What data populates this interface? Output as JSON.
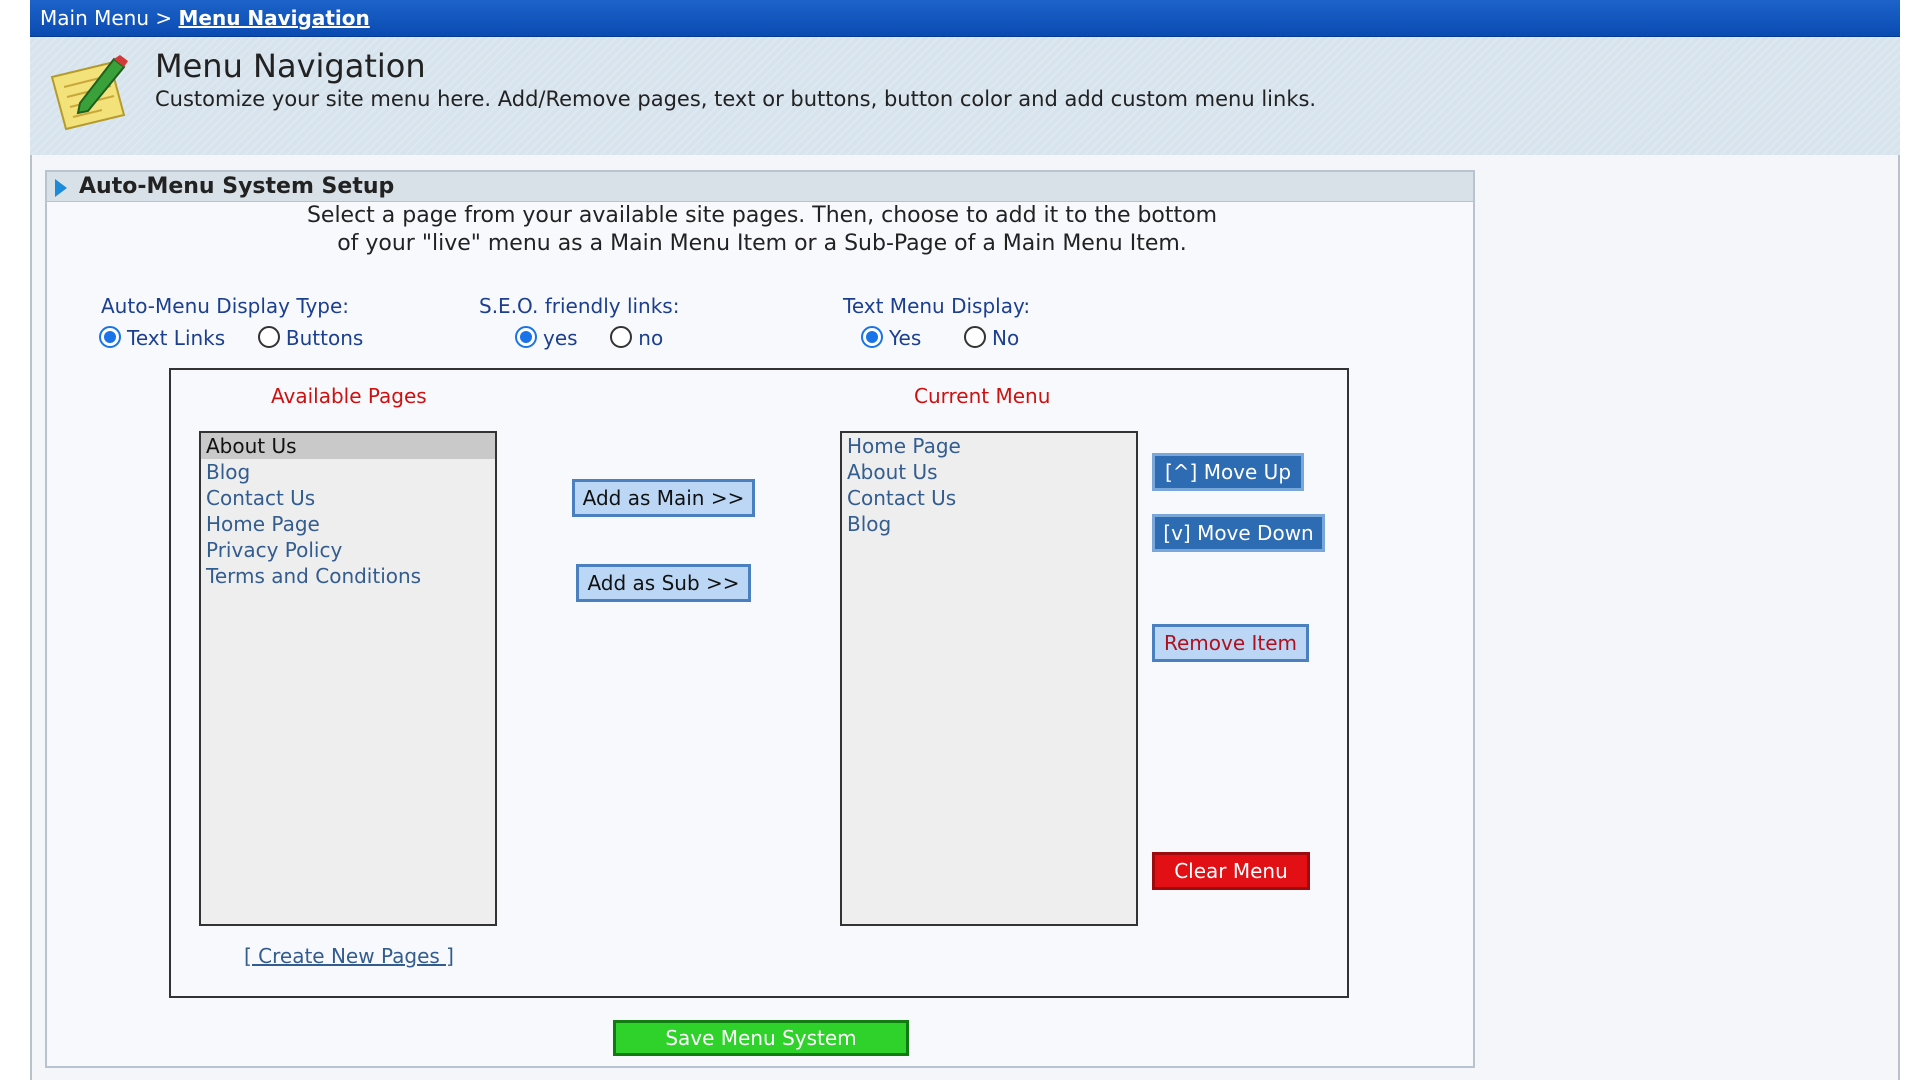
{
  "breadcrumb": {
    "root": "Main Menu",
    "separator": " > ",
    "current": "Menu Navigation"
  },
  "header": {
    "title": "Menu Navigation",
    "subtitle": "Customize your site menu here. Add/Remove pages, text or buttons, button color and add custom menu links.",
    "icon": "notepad-pencil-icon"
  },
  "panel": {
    "title": "Auto-Menu System Setup",
    "instructions_line1": "Select a page from your available site pages. Then, choose to add it to the bottom",
    "instructions_line2": "of your \"live\" menu as a Main Menu Item or a Sub-Page of a Main Menu Item."
  },
  "options": {
    "display_type": {
      "label": "Auto-Menu Display Type:",
      "opt1": "Text Links",
      "opt2": "Buttons",
      "selected": "Text Links"
    },
    "seo": {
      "label": "S.E.O. friendly links:",
      "opt1": "yes",
      "opt2": "no",
      "selected": "yes"
    },
    "text_menu": {
      "label": "Text Menu Display:",
      "opt1": "Yes",
      "opt2": "No",
      "selected": "Yes"
    }
  },
  "available": {
    "heading": "Available Pages",
    "items": [
      "About Us",
      "Blog",
      "Contact Us",
      "Home Page",
      "Privacy Policy",
      "Terms and Conditions"
    ],
    "selected": "About Us",
    "create_link": "[ Create New Pages ]"
  },
  "current": {
    "heading": "Current Menu",
    "items": [
      "Home Page",
      "About Us",
      "Contact Us",
      "Blog"
    ]
  },
  "buttons": {
    "add_main": "Add as Main >>",
    "add_sub": "Add as Sub >>",
    "move_up": "[^] Move Up",
    "move_down": "[v] Move Down",
    "remove": "Remove Item",
    "clear": "Clear Menu",
    "save": "Save Menu System"
  },
  "colors": {
    "breadcrumb_bg": "#0a4bb2",
    "heading_red": "#cc1111",
    "label_blue": "#1c3f8f",
    "clear_red": "#e20f14",
    "save_green": "#2fd12b"
  }
}
